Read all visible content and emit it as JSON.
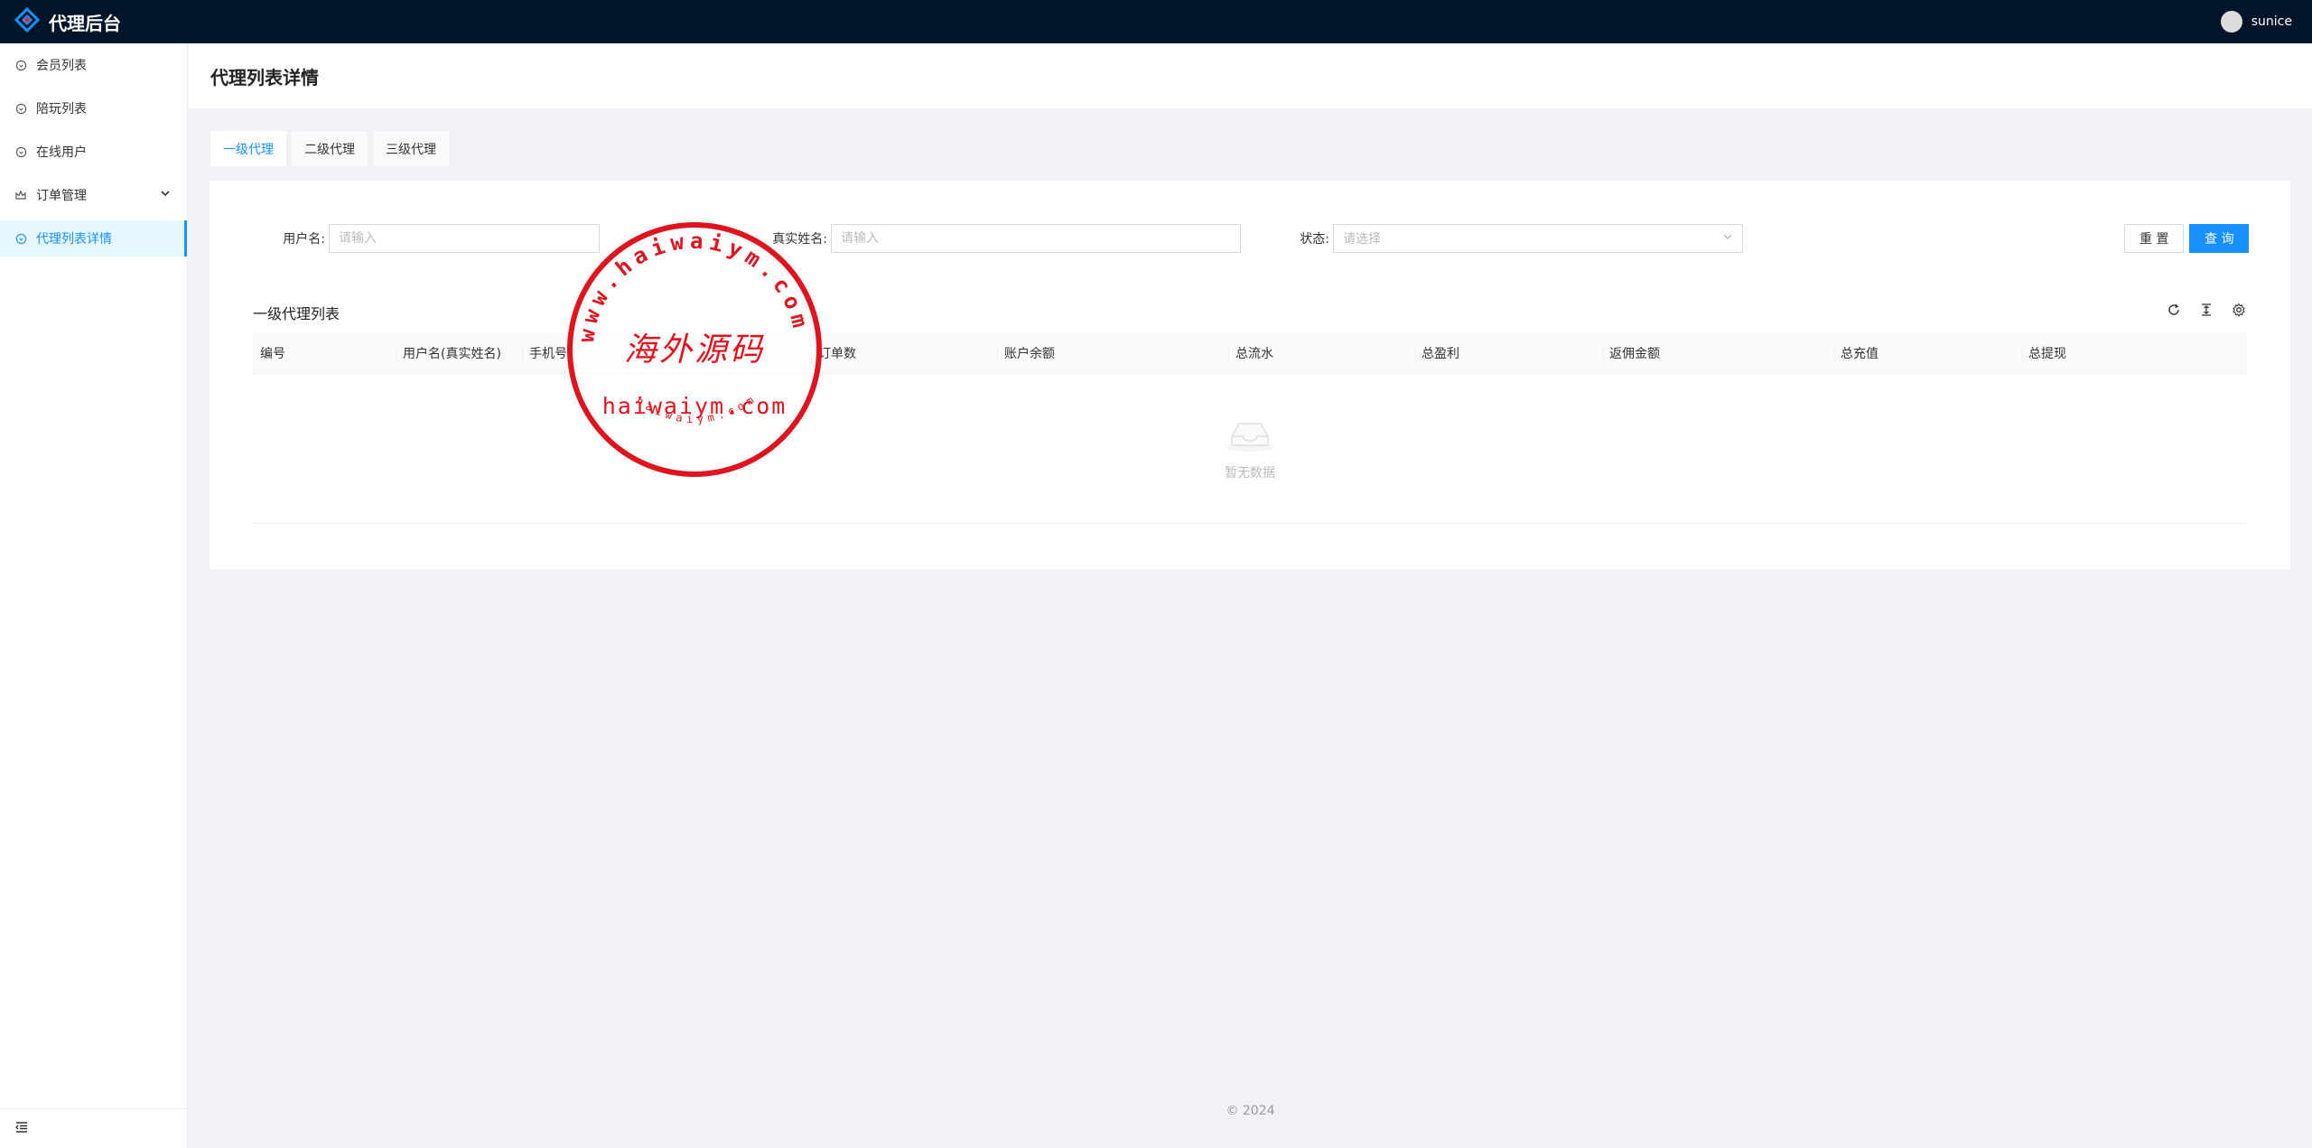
{
  "header": {
    "app_title": "代理后台",
    "user_name": "sunice"
  },
  "sidebar": {
    "items": [
      {
        "label": "会员列表",
        "icon": "circle-icon"
      },
      {
        "label": "陪玩列表",
        "icon": "circle-icon"
      },
      {
        "label": "在线用户",
        "icon": "circle-icon"
      },
      {
        "label": "订单管理",
        "icon": "crown-icon"
      },
      {
        "label": "代理列表详情",
        "icon": "circle-icon"
      }
    ],
    "collapse_icon": "menu-fold-icon"
  },
  "page": {
    "title": "代理列表详情"
  },
  "tabs": [
    {
      "label": "一级代理"
    },
    {
      "label": "二级代理"
    },
    {
      "label": "三级代理"
    }
  ],
  "search": {
    "username_label": "用户名:",
    "username_placeholder": "请输入",
    "realname_label": "真实姓名:",
    "realname_placeholder": "请输入",
    "status_label": "状态:",
    "status_placeholder": "请选择",
    "reset_label": "重 置",
    "query_label": "查 询"
  },
  "table": {
    "title": "一级代理列表",
    "columns": [
      "编号",
      "用户名(真实姓名)",
      "手机号",
      "",
      "订单数",
      "账户余额",
      "总流水",
      "总盈利",
      "返佣金额",
      "总充值",
      "总提现"
    ],
    "empty_text": "暂无数据"
  },
  "stamp": {
    "center_text": "海外源码",
    "domain_text": "haiwaiym.com",
    "ring_text": "www.haiwaiym.com",
    "small_text": "haiwaiym.com",
    "color": "#e0141e"
  },
  "footer": {
    "copyright": "© 2024"
  },
  "colors": {
    "primary": "#1890ff",
    "header_bg": "#001529"
  }
}
